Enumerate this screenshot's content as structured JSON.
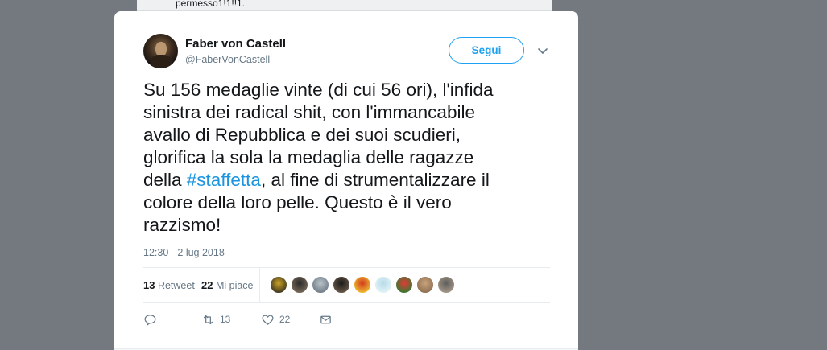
{
  "background_tweet": {
    "text": "permesso1!1!!1."
  },
  "tweet": {
    "author_name": "Faber von Castell",
    "author_handle": "@FaberVonCastell",
    "follow_label": "Segui",
    "text_before_hashtag": "Su 156 medaglie vinte (di cui 56 ori), l'infida\nsinistra dei radical shit, con l'immancabile\navallo di Repubblica e dei suoi scudieri,\nglorifica la sola la medaglia delle ragazze\ndella ",
    "hashtag": "#staffetta",
    "text_after_hashtag": ", al fine di strumentalizzare il\ncolore della loro pelle. Questo è il vero\nrazzismo!",
    "timestamp": "12:30 - 2 lug 2018",
    "retweet_count": "13",
    "retweet_label": "Retweet",
    "like_count": "22",
    "like_label": "Mi piace",
    "action_retweet_count": "13",
    "action_like_count": "22"
  },
  "likers": [
    {
      "colors": [
        "#c9a227",
        "#3a3220"
      ]
    },
    {
      "colors": [
        "#2a2a2a",
        "#7a6a5a"
      ]
    },
    {
      "colors": [
        "#b9c2c8",
        "#6d7a84"
      ]
    },
    {
      "colors": [
        "#1a1a1a",
        "#6b5a49"
      ]
    },
    {
      "colors": [
        "#d23a1e",
        "#f1c232"
      ]
    },
    {
      "colors": [
        "#b6dbe8",
        "#e6f4f8"
      ]
    },
    {
      "colors": [
        "#e53935",
        "#2e7d32"
      ]
    },
    {
      "colors": [
        "#c8a27a",
        "#8d6e52"
      ]
    },
    {
      "colors": [
        "#5d5d5d",
        "#a89a88"
      ]
    }
  ],
  "icons": {
    "reply": "reply-icon",
    "retweet": "retweet-icon",
    "like": "heart-icon",
    "dm": "envelope-icon",
    "more": "chevron-down-icon"
  },
  "colors": {
    "accent": "#1da1f2",
    "hashtag": "#1b95e0",
    "text": "#14171a",
    "secondary": "#657786",
    "overlay": "#73797e"
  }
}
